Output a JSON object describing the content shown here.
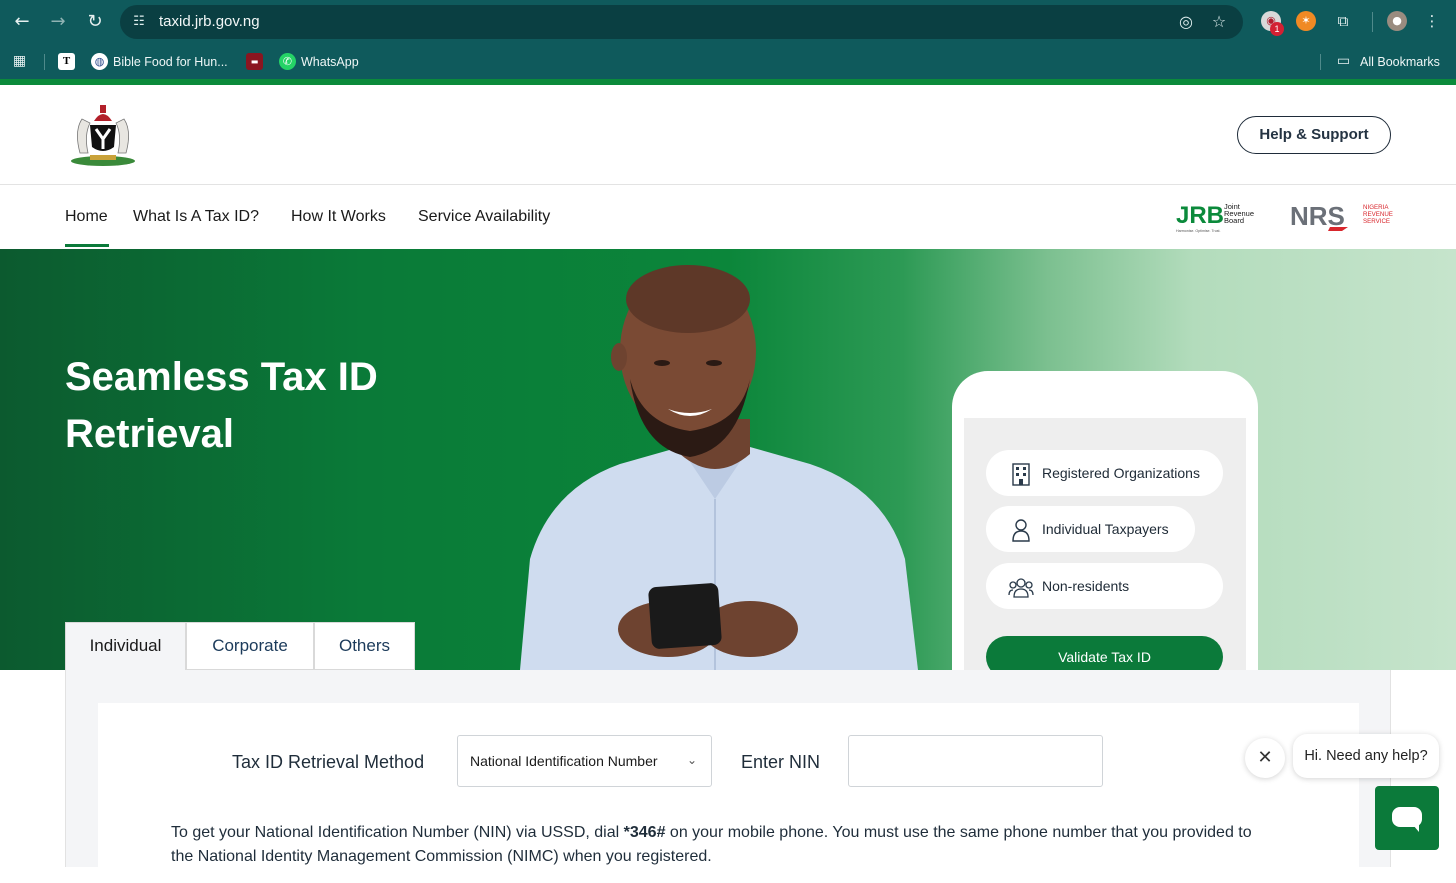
{
  "browser": {
    "url": "taxid.jrb.gov.ng",
    "bookmarks": [
      {
        "label": "Bible Food for Hun..."
      },
      {
        "label": "WhatsApp"
      }
    ],
    "all_bookmarks_label": "All Bookmarks",
    "extension_badge": "1"
  },
  "header": {
    "help_button": "Help & Support"
  },
  "nav": {
    "items": [
      {
        "label": "Home",
        "active": true
      },
      {
        "label": "What Is A Tax ID?"
      },
      {
        "label": "How It Works"
      },
      {
        "label": "Service Availability"
      }
    ],
    "logos": {
      "jrb_mark": "JRB",
      "jrb_text": [
        "Joint",
        "Revenue",
        "Board"
      ],
      "jrb_tagline": "Harmonise. Optimise. Trust.",
      "nrs_mark": "NRS",
      "nrs_text": [
        "NIGERIA",
        "REVENUE",
        "SERVICE"
      ]
    }
  },
  "hero": {
    "title": "Seamless Tax ID Retrieval",
    "phone_options": [
      {
        "label": "Registered Organizations",
        "icon": "building-icon"
      },
      {
        "label": "Individual Taxpayers",
        "icon": "person-icon"
      },
      {
        "label": "Non-residents",
        "icon": "group-icon"
      }
    ],
    "validate_button": "Validate Tax ID"
  },
  "tabs": [
    {
      "label": "Individual",
      "active": true
    },
    {
      "label": "Corporate"
    },
    {
      "label": "Others"
    }
  ],
  "form": {
    "method_label": "Tax ID Retrieval Method",
    "method_value": "National Identification Number",
    "nin_label": "Enter NIN",
    "nin_value": "",
    "note_prefix": "To get your National Identification Number (NIN) via USSD, dial ",
    "note_code": "*346#",
    "note_suffix": " on your mobile phone. You must use the same phone number that you provided to the National Identity Management Commission (NIMC) when you registered."
  },
  "chat": {
    "greeting": "Hi. Need any help?"
  },
  "colors": {
    "chrome": "#0f5a5c",
    "brand_green": "#0b7a3a",
    "nrs_red": "#d8262c"
  }
}
